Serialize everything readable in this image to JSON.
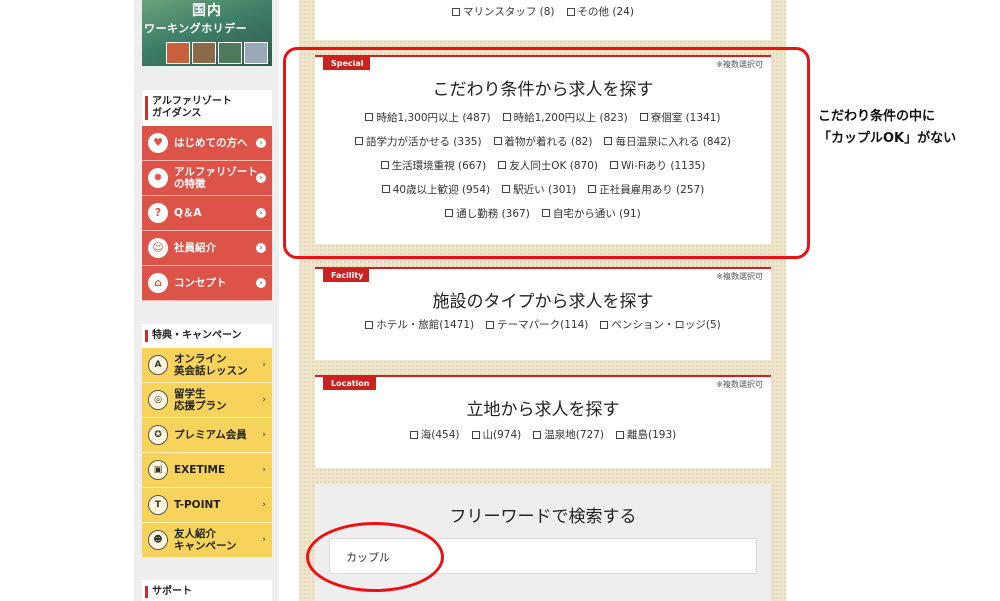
{
  "sidebar": {
    "banner": {
      "line1": "国内",
      "line2": "ワーキングホリデー"
    },
    "guide": {
      "title_line1": "アルファリゾート",
      "title_line2": "ガイダンス",
      "items": [
        {
          "label": "はじめての方へ",
          "icon": "beginner-icon"
        },
        {
          "label_line1": "アルファリゾート",
          "label_line2": "の特徴",
          "icon": "sun-icon"
        },
        {
          "label": "Q＆A",
          "icon": "question-icon"
        },
        {
          "label": "社員紹介",
          "icon": "people-icon"
        },
        {
          "label": "コンセプト",
          "icon": "house-icon"
        }
      ]
    },
    "campaign": {
      "title": "特典・キャンペーン",
      "items": [
        {
          "label_line1": "オンライン",
          "label_line2": "英会話レッスン",
          "icon": "abc-icon"
        },
        {
          "label_line1": "留学生",
          "label_line2": "応援プラン",
          "icon": "globe-icon"
        },
        {
          "label": "プレミアム会員",
          "icon": "medal-icon"
        },
        {
          "label": "EXETIME",
          "icon": "gift-icon"
        },
        {
          "label": "T-POINT",
          "icon": "tpoint-icon"
        },
        {
          "label_line1": "友人紹介",
          "label_line2": "キャンペーン",
          "icon": "friends-icon"
        }
      ]
    },
    "support": {
      "title": "サポート"
    }
  },
  "top_options": [
    {
      "label": "マリンスタッフ (8)"
    },
    {
      "label": "その他 (24)"
    }
  ],
  "special": {
    "tag": "Special",
    "multi": "※複数選択可",
    "title": "こだわり条件から求人を探す",
    "rows": [
      [
        {
          "label": "時給1,300円以上 (487)"
        },
        {
          "label": "時給1,200円以上 (823)"
        },
        {
          "label": "寮個室 (1341)"
        }
      ],
      [
        {
          "label": "語学力が活かせる (335)"
        },
        {
          "label": "着物が着れる (82)"
        },
        {
          "label": "毎日温泉に入れる (842)"
        }
      ],
      [
        {
          "label": "生活環境重視 (667)"
        },
        {
          "label": "友人同士OK (870)"
        },
        {
          "label": "Wi-Fiあり (1135)"
        }
      ],
      [
        {
          "label": "40歳以上歓迎 (954)"
        },
        {
          "label": "駅近い (301)"
        },
        {
          "label": "正社員雇用あり (257)"
        }
      ],
      [
        {
          "label": "通し勤務 (367)"
        },
        {
          "label": "自宅から通い (91)"
        }
      ]
    ]
  },
  "facility": {
    "tag": "Facility",
    "multi": "※複数選択可",
    "title": "施設のタイプから求人を探す",
    "options": [
      {
        "label": "ホテル・旅館(1471)"
      },
      {
        "label": "テーマパーク(114)"
      },
      {
        "label": "ペンション・ロッジ(5)"
      }
    ]
  },
  "location": {
    "tag": "Location",
    "multi": "※複数選択可",
    "title": "立地から求人を探す",
    "options": [
      {
        "label": "海(454)"
      },
      {
        "label": "山(974)"
      },
      {
        "label": "温泉地(727)"
      },
      {
        "label": "離島(193)"
      }
    ]
  },
  "freeword": {
    "title": "フリーワードで検索する",
    "value": "カップル"
  },
  "annotation": {
    "line1": "こだわり条件の中に",
    "line2": "「カップルOK」がない"
  },
  "colors": {
    "accent_red": "#cc2121",
    "sidebar_red": "#dd5347",
    "sidebar_yellow": "#f7d35b",
    "annotation_red": "#e11111"
  }
}
